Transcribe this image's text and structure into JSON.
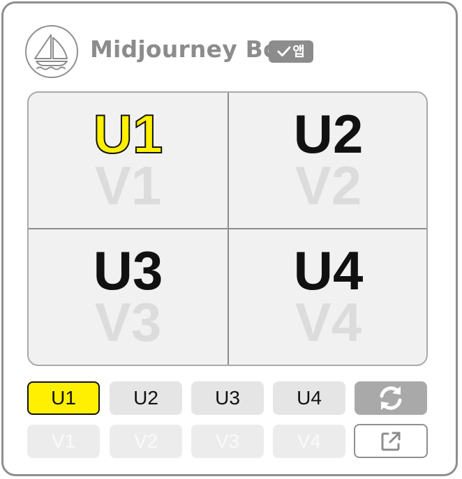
{
  "bot": {
    "name": "Midjourney Bot",
    "badge_label": "앱",
    "avatar_icon": "sailboat-icon",
    "badge_icon": "checkmark-icon"
  },
  "grid": {
    "quadrants": [
      {
        "upscale": "U1",
        "variation": "V1",
        "selected": true
      },
      {
        "upscale": "U2",
        "variation": "V2",
        "selected": false
      },
      {
        "upscale": "U3",
        "variation": "V3",
        "selected": false
      },
      {
        "upscale": "U4",
        "variation": "V4",
        "selected": false
      }
    ]
  },
  "buttons": {
    "upscale": [
      "U1",
      "U2",
      "U3",
      "U4"
    ],
    "variation": [
      "V1",
      "V2",
      "V3",
      "V4"
    ],
    "selected": "U1",
    "reroll_icon": "refresh-icon",
    "open_icon": "external-link-icon"
  },
  "colors": {
    "highlight": "#ffef00",
    "muted_text": "#8c8c8c",
    "faded_variation": "#dcdcdc",
    "button_bg": "#e5e5e5",
    "reroll_bg": "#a9a9a9"
  }
}
